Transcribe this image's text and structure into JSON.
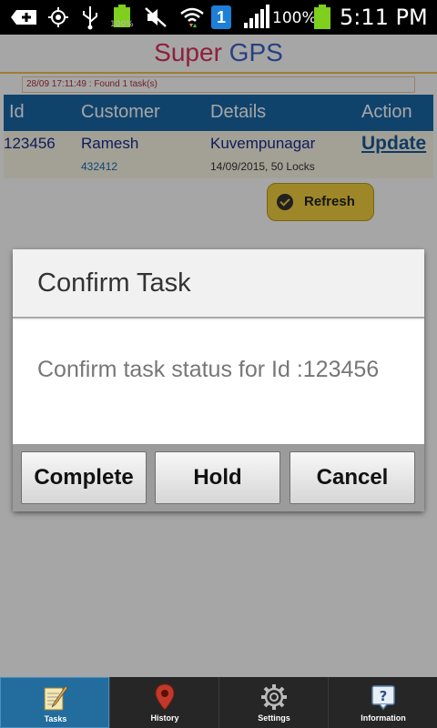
{
  "status_bar": {
    "battery_small_label": "100%",
    "sim_slot": "1",
    "battery_percent": "100%",
    "time": "5:11 PM"
  },
  "app": {
    "title_part1": "Super",
    "title_part2": "GPS",
    "status_message": "28/09 17:11:49 : Found 1 task(s)",
    "colors": {
      "title_super": "#d9325a",
      "title_gps": "#3b64c7",
      "table_header": "#1a68a6",
      "refresh": "#f3cf3e"
    }
  },
  "table": {
    "headers": [
      "Id",
      "Customer",
      "Details",
      "Action"
    ],
    "rows": [
      {
        "id": "123456",
        "customer": "Ramesh",
        "phone": "432412",
        "location": "Kuvempunagar",
        "details": "14/09/2015, 50 Locks",
        "action": "Update"
      }
    ]
  },
  "refresh_label": "Refresh",
  "dialog": {
    "title": "Confirm Task",
    "message": "Confirm task status for Id :123456",
    "buttons": [
      "Complete",
      "Hold",
      "Cancel"
    ]
  },
  "tabs": [
    {
      "label": "Tasks",
      "icon": "notepad-pencil-icon",
      "active": true
    },
    {
      "label": "History",
      "icon": "map-pin-icon",
      "active": false
    },
    {
      "label": "Settings",
      "icon": "gear-icon",
      "active": false
    },
    {
      "label": "Information",
      "icon": "help-bubble-icon",
      "active": false
    }
  ]
}
